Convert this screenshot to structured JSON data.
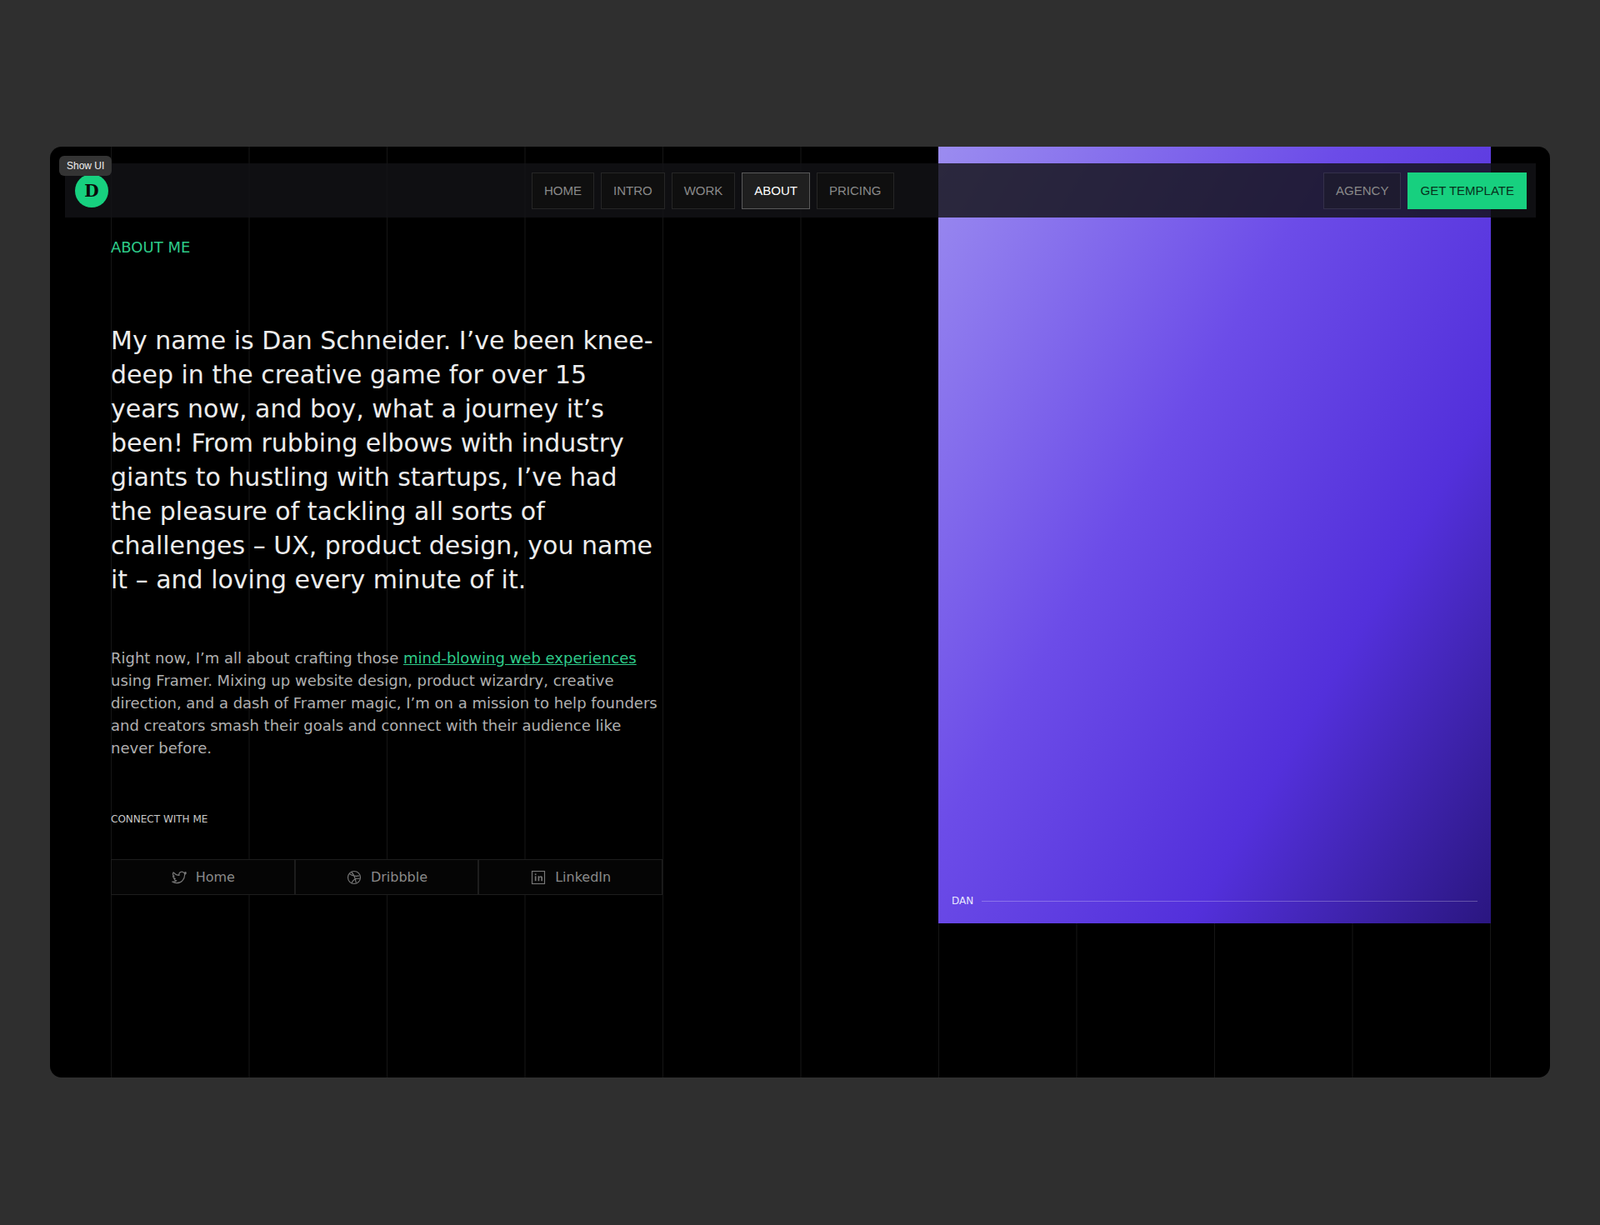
{
  "tooltip": "Show UI",
  "logo": "D",
  "nav": {
    "tabs": [
      {
        "label": "HOME",
        "selected": false
      },
      {
        "label": "INTRO",
        "selected": false
      },
      {
        "label": "WORK",
        "selected": false
      },
      {
        "label": "ABOUT",
        "selected": true
      },
      {
        "label": "PRICING",
        "selected": false
      }
    ],
    "agency": "AGENCY",
    "cta": "GET TEMPLATE"
  },
  "about": {
    "eyebrow": "ABOUT ME",
    "intro": "My name is Dan Schneider. I’ve been knee-deep in the creative game for over 15 years now, and boy, what a journey it’s been! From rubbing elbows with industry giants to hustling with startups, I’ve had the pleasure of tackling all sorts of challenges – UX, product design, you name it – and loving every minute of it.",
    "body": {
      "before": "Right now, I’m all about crafting those ",
      "link": "mind-blowing web experiences",
      "after": " using Framer. Mixing up website design, product wizardry, creative direction, and a dash of Framer magic, I’m on a mission to help founders and creators smash their goals and connect with their audience like never before."
    },
    "connectLabel": "CONNECT WITH ME",
    "socials": [
      {
        "label": "Home",
        "kind": "twitter"
      },
      {
        "label": "Dribbble",
        "kind": "dribbble"
      },
      {
        "label": "LinkedIn",
        "kind": "linkedin"
      }
    ]
  },
  "photo": {
    "caption": "DAN"
  }
}
